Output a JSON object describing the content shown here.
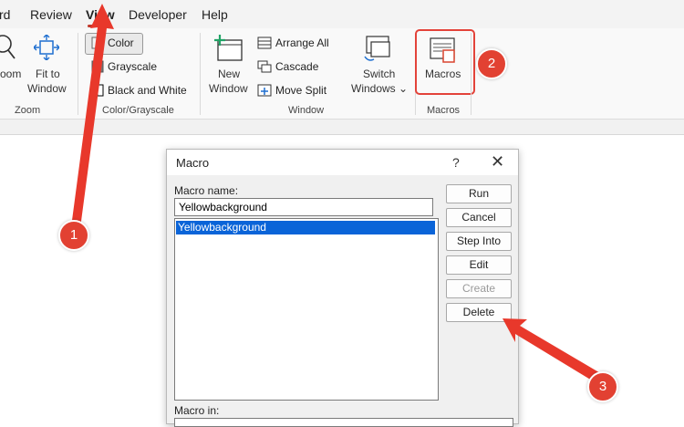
{
  "menu": {
    "items": [
      "rd",
      "Review",
      "View",
      "Developer",
      "Help"
    ],
    "active": "View"
  },
  "ribbon": {
    "zoom": {
      "zoom_label": "oom",
      "fit_line1": "Fit to",
      "fit_line2": "Window",
      "group": "Zoom"
    },
    "color_grayscale": {
      "color": "Color",
      "grayscale": "Grayscale",
      "bw": "Black and White",
      "group": "Color/Grayscale"
    },
    "window": {
      "new_line1": "New",
      "new_line2": "Window",
      "arrange_all": "Arrange All",
      "cascade": "Cascade",
      "move_split": "Move Split",
      "switch_line1": "Switch",
      "switch_line2": "Windows ⌄",
      "group": "Window"
    },
    "macros": {
      "button": "Macros",
      "group": "Macros"
    }
  },
  "dialog": {
    "title": "Macro",
    "help": "?",
    "close": "✕",
    "macro_name_label": "Macro name:",
    "macro_name_value": "Yellowbackground",
    "list_items": [
      "Yellowbackground"
    ],
    "buttons": {
      "run": "Run",
      "cancel": "Cancel",
      "step_into": "Step Into",
      "edit": "Edit",
      "create": "Create",
      "delete": "Delete"
    },
    "macro_in_label": "Macro in:"
  },
  "annotations": {
    "badge1": "1",
    "badge2": "2",
    "badge3": "3"
  },
  "colors": {
    "accent_red": "#e24132",
    "selection_blue": "#0a64d8"
  }
}
